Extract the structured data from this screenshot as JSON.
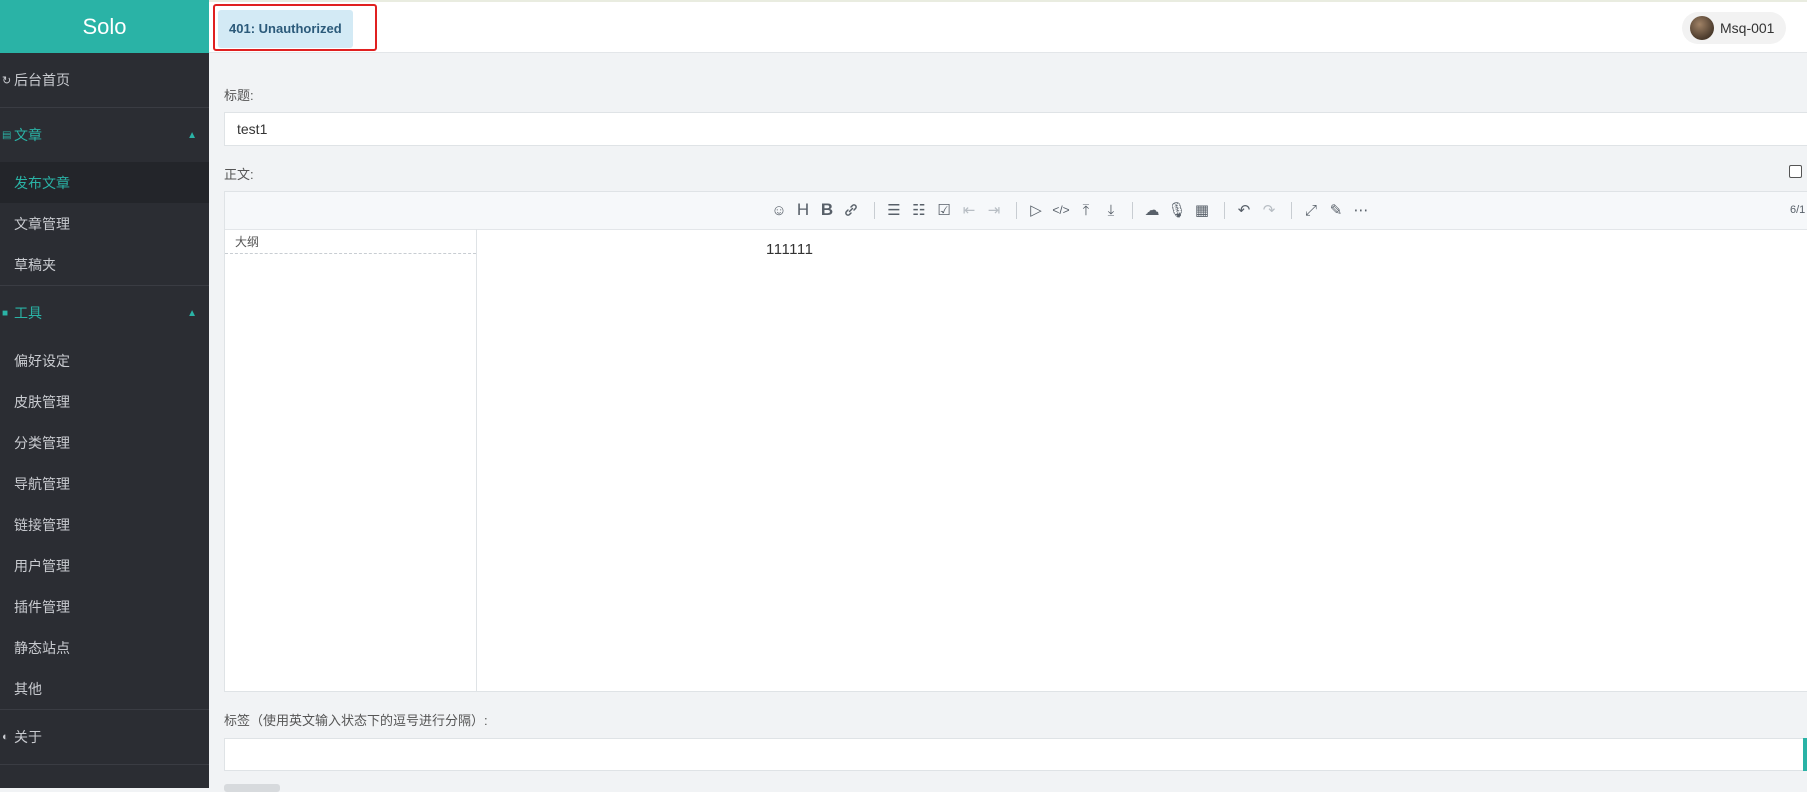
{
  "sidebar": {
    "logo": "Solo",
    "home": "后台首页",
    "groups": [
      {
        "label": "文章",
        "items": [
          "发布文章",
          "文章管理",
          "草稿夹"
        ]
      },
      {
        "label": "工具",
        "items": [
          "偏好设定",
          "皮肤管理",
          "分类管理",
          "导航管理",
          "链接管理",
          "用户管理",
          "插件管理",
          "静态站点",
          "其他"
        ]
      }
    ],
    "about": "关于"
  },
  "header": {
    "error_badge": "401: Unauthorized",
    "username": "Msq-001"
  },
  "form": {
    "title_label": "标题:",
    "title_value": "test1",
    "body_label": "正文:",
    "tags_label": "标签（使用英文输入状态下的逗号进行分隔）:",
    "tags_value": ""
  },
  "editor": {
    "outline_title": "大纲",
    "content": "111111",
    "counter": "6/1"
  },
  "toolbar_icons": [
    "emoji-icon",
    "heading-icon",
    "bold-icon",
    "link-icon",
    "bullet-list-icon",
    "ordered-list-icon",
    "checklist-icon",
    "outdent-icon",
    "indent-icon",
    "quote-icon",
    "code-icon",
    "insert-before-icon",
    "insert-after-icon",
    "upload-icon",
    "record-icon",
    "table-icon",
    "undo-icon",
    "redo-icon",
    "fullscreen-icon",
    "edit-mode-icon",
    "more-icon"
  ],
  "colors": {
    "accent": "#2ab3a6",
    "sidebar_bg": "#2b2d33",
    "error_badge_bg": "#d3eaf5",
    "error_box_border": "#e02020"
  }
}
